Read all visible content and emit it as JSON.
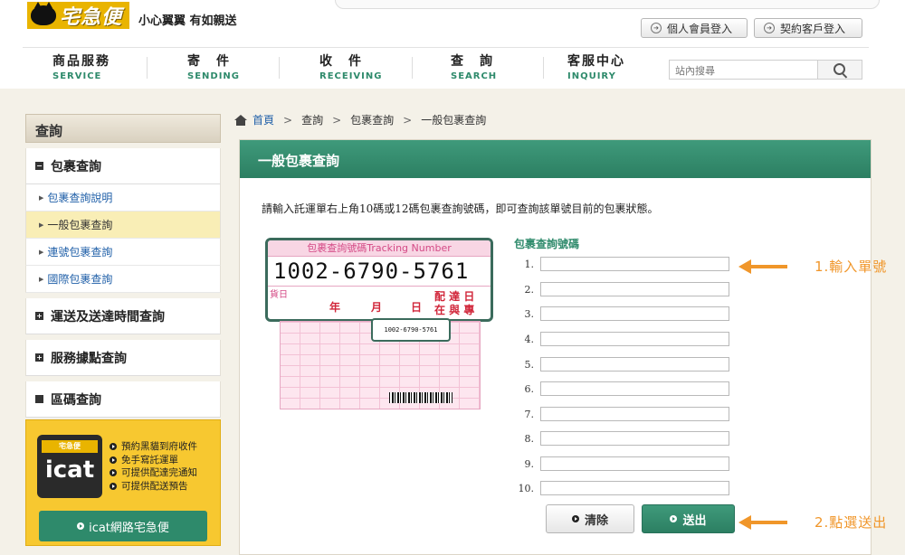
{
  "header": {
    "brand": "宅急便",
    "slogan": "小心翼翼 有如親送",
    "member_login": "個人會員登入",
    "contract_login": "契約客戶登入",
    "search_placeholder": "站內搜尋"
  },
  "nav": [
    {
      "zh": "商品服務",
      "en": "SERVICE"
    },
    {
      "zh": "寄　件",
      "en": "SENDING"
    },
    {
      "zh": "收　件",
      "en": "RECEIVING"
    },
    {
      "zh": "查　詢",
      "en": "SEARCH"
    },
    {
      "zh": "客服中心",
      "en": "INQUIRY"
    }
  ],
  "sidebar": {
    "title": "查詢",
    "section1": "包裹查詢",
    "subs": [
      "包裹查詢說明",
      "一般包裹查詢",
      "連號包裹查詢",
      "國際包裹查詢"
    ],
    "section2": "運送及送達時間查詢",
    "section3": "服務據點查詢",
    "section4": "區碼查詢"
  },
  "icat": {
    "mini": "宅急便",
    "logo": "icat",
    "features": [
      "預約黑貓到府收件",
      "免手寫託運單",
      "可提供配達完通知",
      "可提供配送預告"
    ],
    "button": "icat網路宅急便"
  },
  "breadcrumb": [
    "首頁",
    "查詢",
    "包裹查詢",
    "一般包裹查詢"
  ],
  "panel": {
    "title": "一般包裹查詢",
    "description": "請輸入託運單右上角10碼或12碼包裹查詢號碼，即可查詢該單號目前的包裹狀態。",
    "zoom_title": "包裹查詢號碼Tracking Number",
    "zoom_number": "1002-6790-5761",
    "zoom_date": "貨日",
    "zoom_year": "年",
    "zoom_month": "月",
    "zoom_day": "日",
    "zoom_delivery": "配 達 日",
    "zoom_delivery2": "在 與 專",
    "waybill_number": "1002-6790-5761",
    "form_label": "包裹查詢號碼",
    "row_numbers": [
      "1.",
      "2.",
      "3.",
      "4.",
      "5.",
      "6.",
      "7.",
      "8.",
      "9.",
      "10."
    ],
    "clear_button": "清除",
    "send_button": "送出"
  },
  "annotations": {
    "step1": "1.輸入單號",
    "step2": "2.點選送出"
  },
  "colors": {
    "brand_yellow": "#e9b400",
    "green": "#2e8a6b",
    "orange": "#f0962a"
  }
}
